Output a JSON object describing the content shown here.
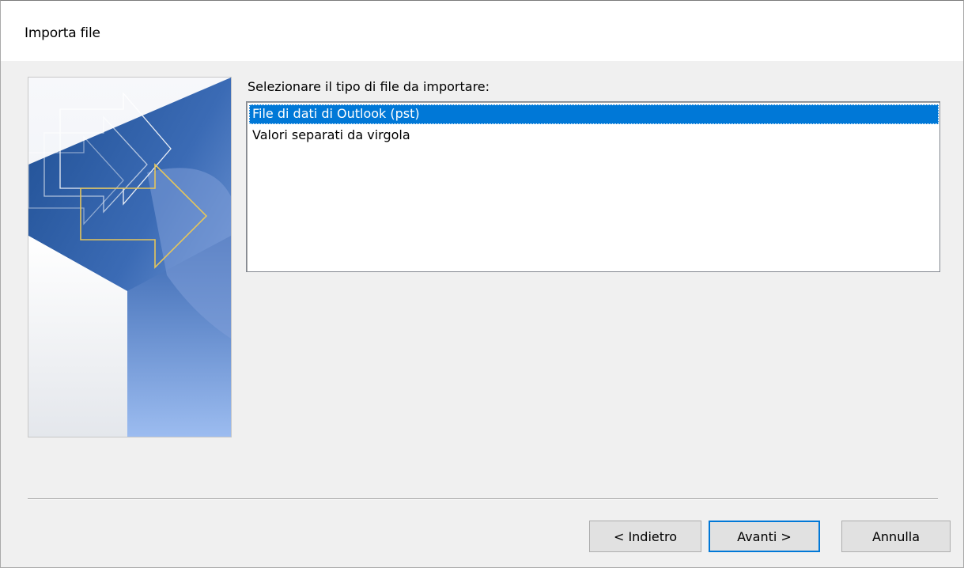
{
  "dialog": {
    "title": "Importa file"
  },
  "main": {
    "prompt": "Selezionare il tipo di file da importare:",
    "file_types": [
      {
        "label": "File di dati di Outlook (pst)",
        "selected": true
      },
      {
        "label": "Valori separati da virgola",
        "selected": false
      }
    ]
  },
  "buttons": {
    "back_label": "< Indietro",
    "next_label": "Avanti >",
    "cancel_label": "Annulla"
  },
  "colors": {
    "selection": "#0078d7",
    "banner_dark": "#2f5b9c",
    "banner_light": "#9ab6e6",
    "arrow_outline": "#e6c65a"
  },
  "icons": {
    "banner": "import-arrows-illustration"
  }
}
